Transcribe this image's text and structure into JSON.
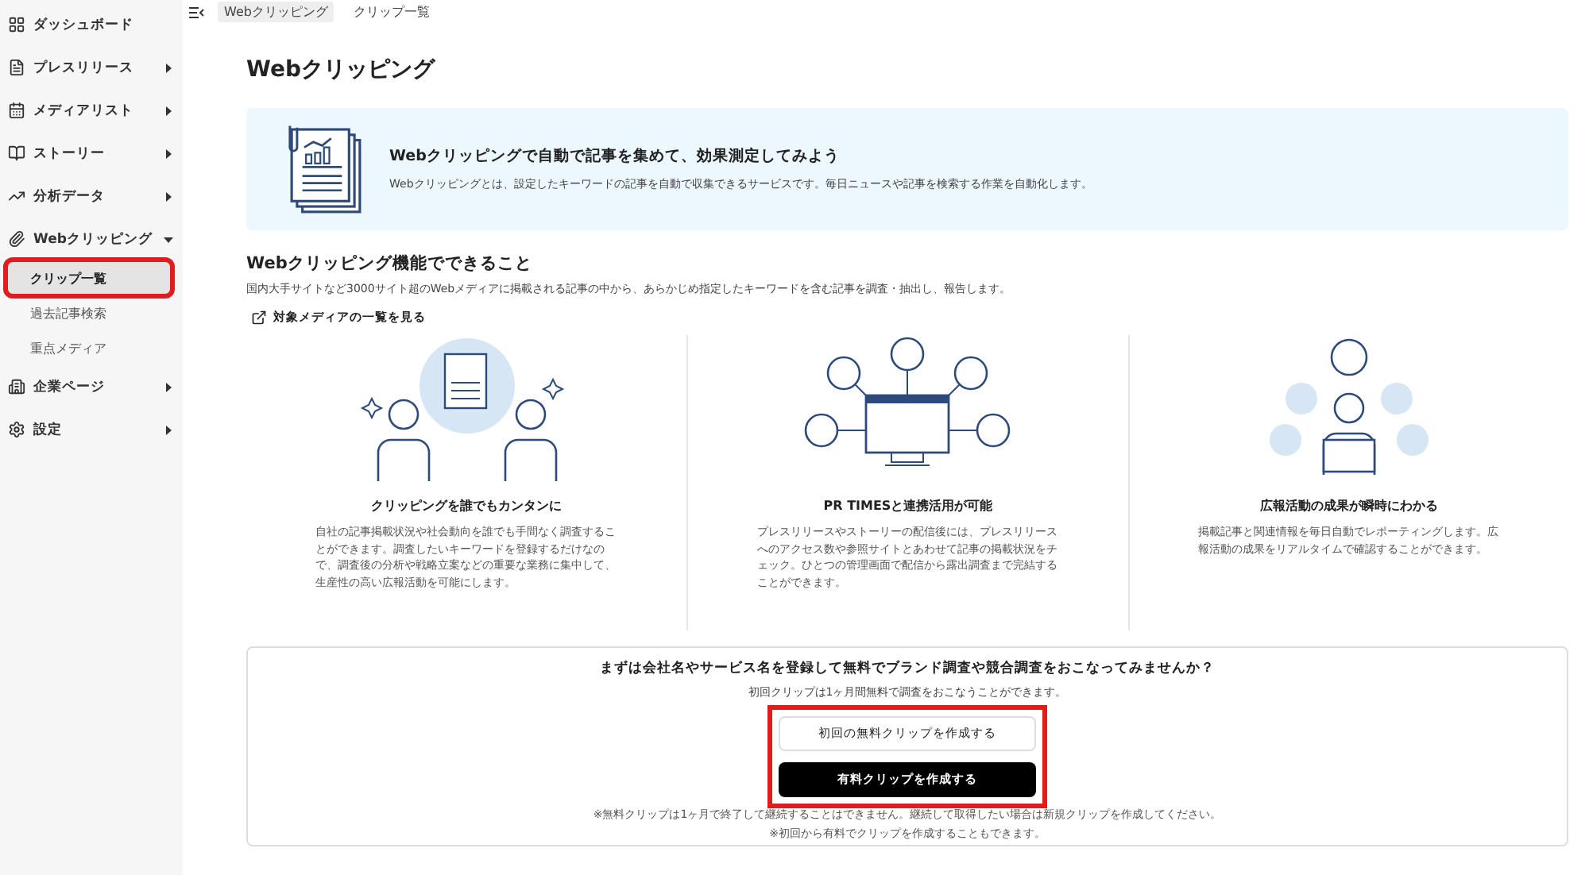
{
  "sidebar": {
    "items": [
      {
        "label": "ダッシュボード",
        "has_submenu": false
      },
      {
        "label": "プレスリリース",
        "has_submenu": true,
        "expanded": false
      },
      {
        "label": "メディアリスト",
        "has_submenu": true,
        "expanded": false
      },
      {
        "label": "ストーリー",
        "has_submenu": true,
        "expanded": false
      },
      {
        "label": "分析データ",
        "has_submenu": true,
        "expanded": false
      },
      {
        "label": "Webクリッピング",
        "has_submenu": true,
        "expanded": true,
        "children": [
          {
            "label": "クリップ一覧",
            "selected": true,
            "highlighted": true
          },
          {
            "label": "過去記事検索",
            "selected": false,
            "highlighted": false
          },
          {
            "label": "重点メディア",
            "selected": false,
            "highlighted": false
          }
        ]
      },
      {
        "label": "企業ページ",
        "has_submenu": true,
        "expanded": false
      },
      {
        "label": "設定",
        "has_submenu": true,
        "expanded": false
      }
    ]
  },
  "breadcrumb": [
    {
      "label": "Webクリッピング",
      "current": false
    },
    {
      "label": "クリップ一覧",
      "current": true
    }
  ],
  "page_title": "Webクリッピング",
  "banner": {
    "title": "Webクリッピングで自動で記事を集めて、効果測定してみよう",
    "text": "Webクリッピングとは、設定したキーワードの記事を自動で収集できるサービスです。毎日ニュースや記事を検索する作業を自動化します。"
  },
  "features_section": {
    "title": "Webクリッピング機能でできること",
    "description": "国内大手サイトなど3000サイト超のWebメディアに掲載される記事の中から、あらかじめ指定したキーワードを含む記事を調査・抽出し、報告します。",
    "link": "対象メディアの一覧を見る",
    "features": [
      {
        "kind": "people",
        "title": "クリッピングを誰でもカンタンに",
        "text": "自社の記事掲載状況や社会動向を誰でも手間なく調査することができます。調査したいキーワードを登録するだけなので、調査後の分析や戦略立案などの重要な業務に集中して、生産性の高い広報活動を可能にします。"
      },
      {
        "kind": "network",
        "title": "PR TIMESと連携活用が可能",
        "text": "プレスリリースやストーリーの配信後には、プレスリリースへのアクセス数や参照サイトとあわせて記事の掲載状況をチェック。ひとつの管理画面で配信から露出調査まで完結することができます。"
      },
      {
        "kind": "worker",
        "title": "広報活動の成果が瞬時にわかる",
        "text": "掲載記事と関連情報を毎日自動でレポーティングします。広報活動の成果をリアルタイムで確認することができます。"
      }
    ]
  },
  "cta": {
    "title": "まずは会社名やサービス名を登録して無料でブランド調査や競合調査をおこなってみませんか？",
    "subtitle": "初回クリップは1ヶ月間無料で調査をおこなうことができます。",
    "buttons_highlighted": true,
    "buttons": [
      {
        "label": "初回の無料クリップを作成する",
        "kind": "secondary"
      },
      {
        "label": "有料クリップを作成する",
        "kind": "primary"
      }
    ],
    "notes": [
      "※無料クリップは1ヶ月で終了して継続することはできません。継続して取得したい場合は新規クリップを作成してください。",
      "※初回から有料でクリップを作成することもできます。"
    ]
  }
}
